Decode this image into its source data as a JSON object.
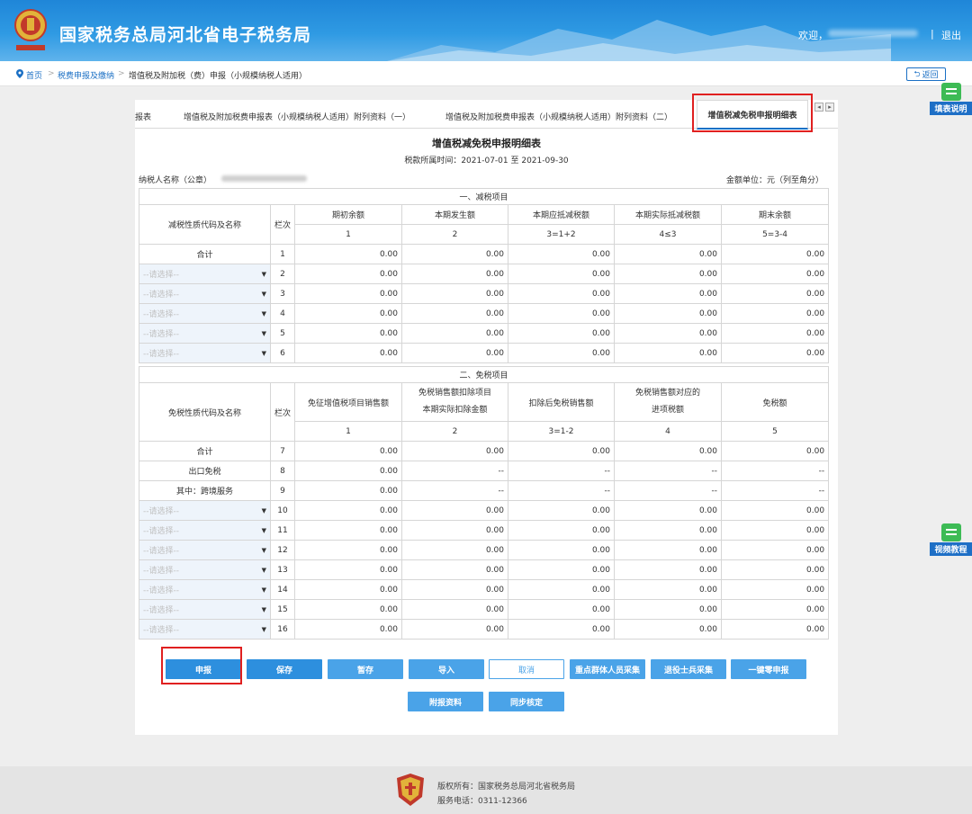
{
  "header": {
    "title": "国家税务总局河北省电子税务局",
    "welcome": "欢迎，",
    "separator": "|",
    "logout": "退出",
    "brand_color": "#2f9ae3"
  },
  "breadcrumb": {
    "home": "首页",
    "sep": ">",
    "level1": "税费申报及缴纳",
    "current": "增值税及附加税（费）申报（小规模纳税人适用）",
    "back": "返回"
  },
  "side_tools": {
    "fill_guide": "填表说明",
    "video": "视频教程"
  },
  "tabs": [
    {
      "label": "报表"
    },
    {
      "label": "增值税及附加税费申报表（小规模纳税人适用）附列资料（一）"
    },
    {
      "label": "增值税及附加税费申报表（小规模纳税人适用）附列资料（二）"
    },
    {
      "label": "增值税减免税申报明细表"
    }
  ],
  "tab_arrows": {
    "left": "◂",
    "right": "▸"
  },
  "form": {
    "title": "增值税减免税申报明细表",
    "period": "税款所属时间：2021-07-01 至 2021-09-30",
    "taxpayer_label": "纳税人名称（公章）",
    "unit": "金额单位：元（列至角分）",
    "select_placeholder": "--请选择--",
    "select_arrow": "▼"
  },
  "reduction": {
    "section_title": "一、减税项目",
    "name_header": "减税性质代码及名称",
    "row_header": "栏次",
    "columns": [
      "期初余额",
      "本期发生额",
      "本期应抵减税额",
      "本期实际抵减税额",
      "期末余额"
    ],
    "col_numbers": [
      "1",
      "2",
      "3=1+2",
      "4≤3",
      "5=3-4"
    ],
    "total_row": {
      "name": "合计",
      "no": "1",
      "values": [
        "0.00",
        "0.00",
        "0.00",
        "0.00",
        "0.00"
      ]
    },
    "rows": [
      {
        "no": "2",
        "values": [
          "0.00",
          "0.00",
          "0.00",
          "0.00",
          "0.00"
        ]
      },
      {
        "no": "3",
        "values": [
          "0.00",
          "0.00",
          "0.00",
          "0.00",
          "0.00"
        ]
      },
      {
        "no": "4",
        "values": [
          "0.00",
          "0.00",
          "0.00",
          "0.00",
          "0.00"
        ]
      },
      {
        "no": "5",
        "values": [
          "0.00",
          "0.00",
          "0.00",
          "0.00",
          "0.00"
        ]
      },
      {
        "no": "6",
        "values": [
          "0.00",
          "0.00",
          "0.00",
          "0.00",
          "0.00"
        ]
      }
    ]
  },
  "exemption": {
    "section_title": "二、免税项目",
    "name_header": "免税性质代码及名称",
    "row_header": "栏次",
    "columns": [
      [
        "免征增值税项目销售额"
      ],
      [
        "免税销售额扣除项目",
        "本期实际扣除金额"
      ],
      [
        "扣除后免税销售额"
      ],
      [
        "免税销售额对应的",
        "进项税额"
      ],
      [
        "免税额"
      ]
    ],
    "col_numbers": [
      "1",
      "2",
      "3=1-2",
      "4",
      "5"
    ],
    "fixed_rows": [
      {
        "name": "合计",
        "no": "7",
        "values": [
          "0.00",
          "0.00",
          "0.00",
          "0.00",
          "0.00"
        ]
      },
      {
        "name": "出口免税",
        "no": "8",
        "values": [
          "0.00",
          "--",
          "--",
          "--",
          "--"
        ]
      },
      {
        "name": "其中：跨境服务",
        "no": "9",
        "values": [
          "0.00",
          "--",
          "--",
          "--",
          "--"
        ]
      }
    ],
    "rows": [
      {
        "no": "10",
        "values": [
          "0.00",
          "0.00",
          "0.00",
          "0.00",
          "0.00"
        ]
      },
      {
        "no": "11",
        "values": [
          "0.00",
          "0.00",
          "0.00",
          "0.00",
          "0.00"
        ]
      },
      {
        "no": "12",
        "values": [
          "0.00",
          "0.00",
          "0.00",
          "0.00",
          "0.00"
        ]
      },
      {
        "no": "13",
        "values": [
          "0.00",
          "0.00",
          "0.00",
          "0.00",
          "0.00"
        ]
      },
      {
        "no": "14",
        "values": [
          "0.00",
          "0.00",
          "0.00",
          "0.00",
          "0.00"
        ]
      },
      {
        "no": "15",
        "values": [
          "0.00",
          "0.00",
          "0.00",
          "0.00",
          "0.00"
        ]
      },
      {
        "no": "16",
        "values": [
          "0.00",
          "0.00",
          "0.00",
          "0.00",
          "0.00"
        ]
      }
    ]
  },
  "buttons": {
    "declare": "申报",
    "save": "保存",
    "temp_save": "暂存",
    "import": "导入",
    "cancel": "取消",
    "key_groups": "重点群体人员采集",
    "veterans": "退役士兵采集",
    "zero_declare": "一键零申报",
    "attachments": "附报资料",
    "sync_check": "同步核定"
  },
  "footer": {
    "copyright": "版权所有：国家税务总局河北省税务局",
    "phone": "服务电话：0311-12366"
  }
}
